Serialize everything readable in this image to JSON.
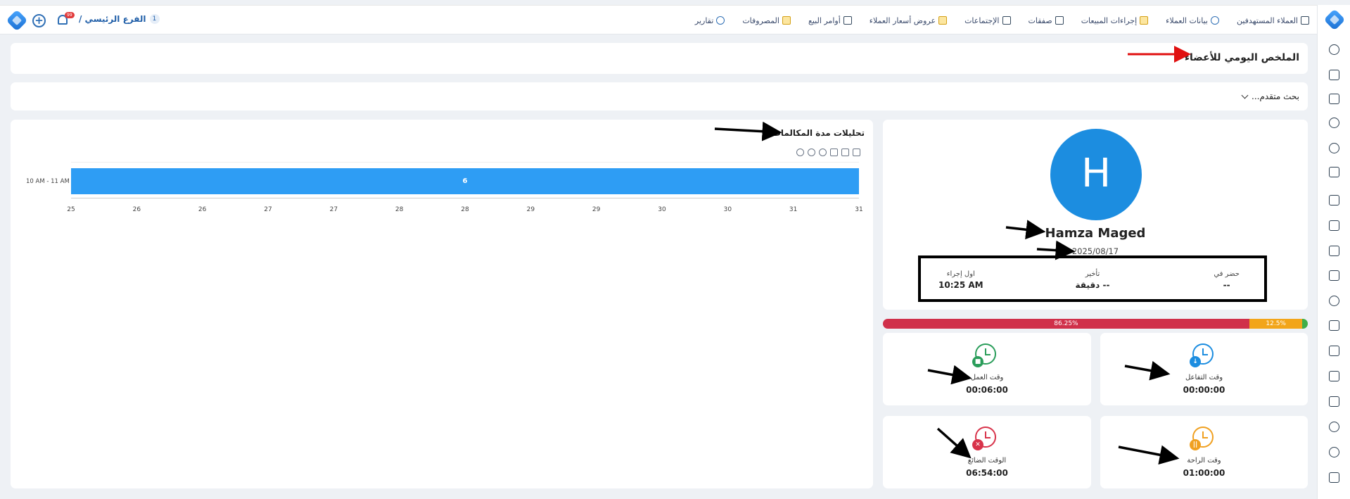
{
  "topbar": {
    "branch": "الفرع الرئيسي /",
    "branch_count": "1",
    "notif_badge": "99",
    "nav": [
      {
        "label": "العملاء المستهدفين",
        "icon": "target-users-icon"
      },
      {
        "label": "بيانات العملاء",
        "icon": "customer-data-icon"
      },
      {
        "label": "إجراءات المبيعات",
        "icon": "sales-actions-icon"
      },
      {
        "label": "صفقات",
        "icon": "deals-icon"
      },
      {
        "label": "الإجتماعات",
        "icon": "meetings-icon"
      },
      {
        "label": "عروض أسعار العملاء",
        "icon": "quotes-icon"
      },
      {
        "label": "أوامر البيع",
        "icon": "sales-orders-icon"
      },
      {
        "label": "المصروفات",
        "icon": "expenses-icon"
      },
      {
        "label": "تقارير",
        "icon": "reports-icon"
      }
    ]
  },
  "page": {
    "title": "الملخص اليومي للأعضاء",
    "advanced_search": "بحث متقدم..."
  },
  "chart_section": {
    "title": "تحليلات مدة المكالمات"
  },
  "chart_data": {
    "type": "bar",
    "orientation": "horizontal",
    "categories": [
      "10 AM - 11 AM"
    ],
    "values": [
      6
    ],
    "xticks": [
      "25",
      "26",
      "26",
      "27",
      "27",
      "28",
      "28",
      "29",
      "29",
      "30",
      "30",
      "31",
      "31"
    ],
    "color": "#2e9df4"
  },
  "profile": {
    "avatar_letter": "H",
    "name": "Hamza Maged",
    "date": "2025/08/17",
    "stats": {
      "present_label": "حضر في",
      "present_value": "--",
      "late_label": "تأخير",
      "late_value": "-- دقيقة",
      "first_action_label": "اول إجراء",
      "first_action_value": "10:25 AM"
    }
  },
  "progress": {
    "segments": [
      {
        "label": "86.25%",
        "value": 86.25,
        "color": "#d0304a"
      },
      {
        "label": "12.5%",
        "value": 12.5,
        "color": "#f2a51a"
      },
      {
        "label": "",
        "value": 1.25,
        "color": "#3fae49"
      }
    ]
  },
  "tiles": {
    "interaction": {
      "label": "وقت التفاعل",
      "value": "00:00:00",
      "color": "#1c8de0"
    },
    "work": {
      "label": "وقت العمل",
      "value": "00:06:00",
      "color": "#2a9d5a"
    },
    "break": {
      "label": "وقت الراحة",
      "value": "01:00:00",
      "color": "#f0a020"
    },
    "wasted": {
      "label": "الوقت الضائع",
      "value": "06:54:00",
      "color": "#d8334a"
    }
  }
}
